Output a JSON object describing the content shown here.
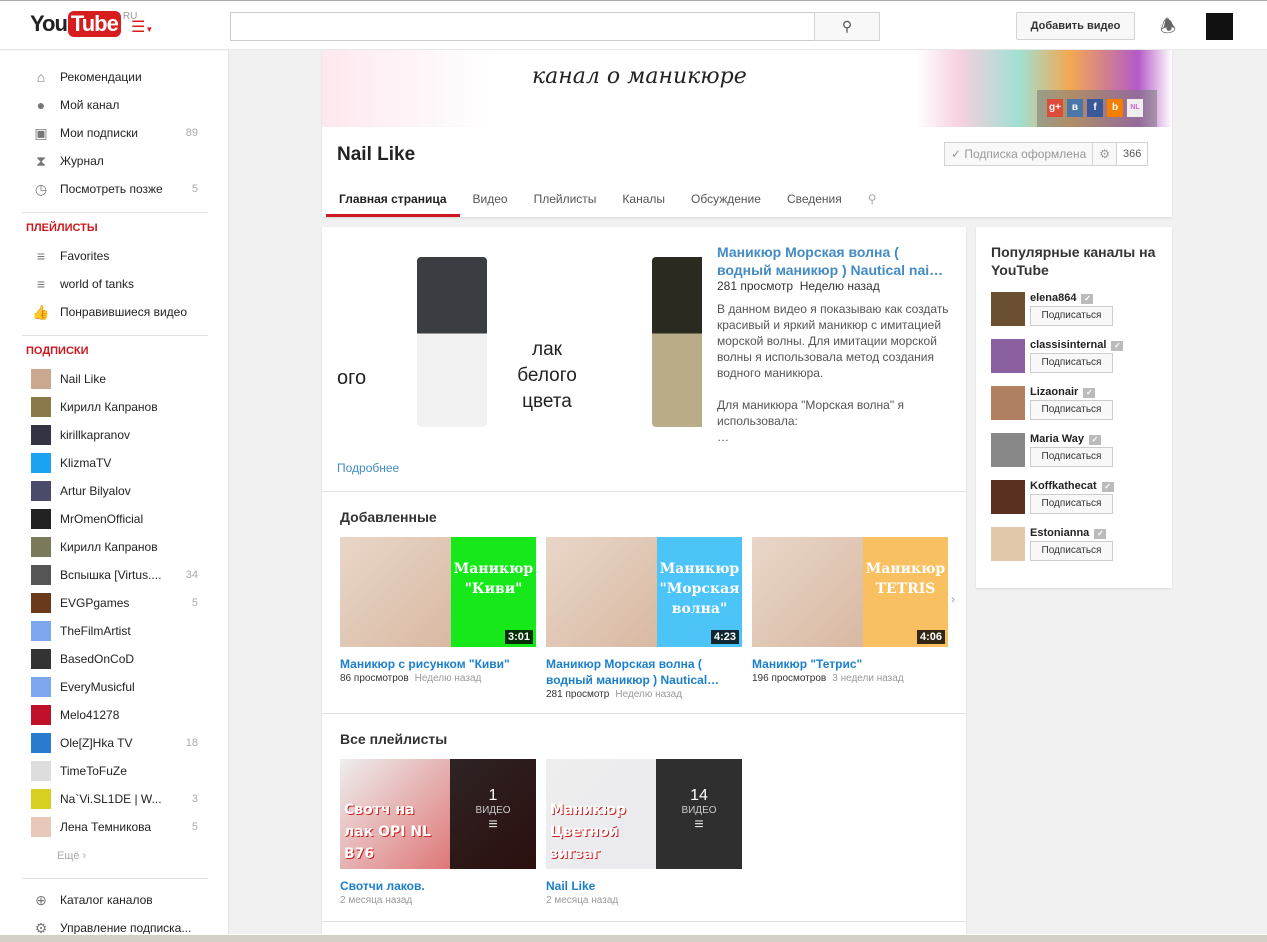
{
  "header": {
    "logo_you": "You",
    "logo_tube": "Tube",
    "logo_region": "RU",
    "search_placeholder": "",
    "upload_label": "Добавить видео"
  },
  "sidebar": {
    "nav": [
      {
        "label": "Рекомендации",
        "icon": "home-icon"
      },
      {
        "label": "Мой канал",
        "icon": "user-icon"
      },
      {
        "label": "Мои подписки",
        "count": "89",
        "icon": "subscriptions-icon"
      },
      {
        "label": "Журнал",
        "icon": "hourglass-icon"
      },
      {
        "label": "Посмотреть позже",
        "count": "5",
        "icon": "clock-icon"
      }
    ],
    "playlists_title": "ПЛЕЙЛИСТЫ",
    "playlists": [
      {
        "label": "Favorites"
      },
      {
        "label": "world of tanks"
      },
      {
        "label": "Понравившиеся видео"
      }
    ],
    "subs_title": "ПОДПИСКИ",
    "subs": [
      {
        "label": "Nail Like",
        "color": "#c9a88f"
      },
      {
        "label": "Кирилл Капранов",
        "color": "#8a7a4a"
      },
      {
        "label": "kirillkapranov",
        "color": "#334"
      },
      {
        "label": "KlizmaTV",
        "color": "#1aa3f0"
      },
      {
        "label": "Artur Bilyalov",
        "color": "#4a4a6a"
      },
      {
        "label": "MrOmenOfficial",
        "color": "#222"
      },
      {
        "label": "Кирилл Капранов",
        "color": "#7a7a5a"
      },
      {
        "label": "Вспышка [Virtus....",
        "count": "34",
        "color": "#555"
      },
      {
        "label": "EVGPgames",
        "count": "5",
        "color": "#6a3a1a"
      },
      {
        "label": "TheFilmArtist",
        "color": "#7fa7f0"
      },
      {
        "label": "BasedOnCoD",
        "color": "#333"
      },
      {
        "label": "EveryMusicful",
        "color": "#7fa7f0"
      },
      {
        "label": "Melo41278",
        "color": "#c0102a"
      },
      {
        "label": "Ole[Z]Hka TV",
        "count": "18",
        "color": "#2a7ad0"
      },
      {
        "label": "TimeToFuZe",
        "color": "#ddd"
      },
      {
        "label": "Na`Vi.SL1DE | W...",
        "count": "3",
        "color": "#d8d020"
      },
      {
        "label": "Лена Темникова",
        "count": "5",
        "color": "#e8c8b8"
      }
    ],
    "more_label": "Ещё ›",
    "bottom": [
      {
        "label": "Каталог каналов"
      },
      {
        "label": "Управление подписка..."
      }
    ]
  },
  "banner": {
    "tagline": "канал о маникюре",
    "social": [
      "g+",
      "в",
      "f",
      "b",
      "NL"
    ]
  },
  "channel": {
    "name": "Nail Like",
    "subscribed_label": "Подписка оформлена",
    "subscriber_count": "366",
    "tabs": [
      "Главная страница",
      "Видео",
      "Плейлисты",
      "Каналы",
      "Обсуждение",
      "Сведения"
    ]
  },
  "featured": {
    "image_text_left": "ого",
    "image_text": "лак белого цвета",
    "title": "Маникюр Морская волна ( водный маникюр ) Nautical nai…",
    "views": "281 просмотр",
    "age": "Неделю назад",
    "description": "В данном видео я показываю как создать красивый и яркий маникюр с имитацией морской волны. Для имитации морской волны я использовала метод создания водного маникюра.\n\nДля маникюра \"Морская волна\" я использовала:\n…",
    "more_label": "Подробнее"
  },
  "uploads": {
    "title": "Добавленные",
    "videos": [
      {
        "title": "Маникюр с рисунком \"Киви\"",
        "views": "86 просмотров",
        "age": "Неделю назад",
        "duration": "3:01",
        "thumb_text": "Маникюр \"Киви\"",
        "color": "#16e81a"
      },
      {
        "title": "Маникюр Морская волна ( водный маникюр ) Nautical…",
        "views": "281 просмотр",
        "age": "Неделю назад",
        "duration": "4:23",
        "thumb_text": "Маникюр \"Морская волна\"",
        "color": "#4cc4f8"
      },
      {
        "title": "Маникюр \"Тетрис\"",
        "views": "196 просмотров",
        "age": "3 недели назад",
        "duration": "4:06",
        "thumb_text": "Маникюр TETRIS",
        "color": "#f8c060"
      }
    ]
  },
  "playlists": {
    "title": "Все плейлисты",
    "video_word": "ВИДЕО",
    "items": [
      {
        "title": "Свотчи лаков.",
        "age": "2 месяца назад",
        "count": "1",
        "thumb_text": "Свотч на лак OPI NL B76",
        "color": "#d84848"
      },
      {
        "title": "Nail Like",
        "age": "2 месяца назад",
        "count": "14",
        "thumb_text": "Маникюр Цветной зигзаг",
        "color": "#e8e8f0"
      }
    ]
  },
  "popular": {
    "title": "Популярные каналы на YouTube",
    "subscribe_label": "Подписаться",
    "channels": [
      {
        "name": "elena864",
        "color": "#6a5030"
      },
      {
        "name": "classisinternal",
        "color": "#8a60a0"
      },
      {
        "name": "Lizaonair",
        "color": "#b08060"
      },
      {
        "name": "Maria Way",
        "color": "#888"
      },
      {
        "name": "Koffkathecat",
        "color": "#5a3020"
      },
      {
        "name": "Estonianna",
        "color": "#e0c8a8"
      }
    ]
  }
}
